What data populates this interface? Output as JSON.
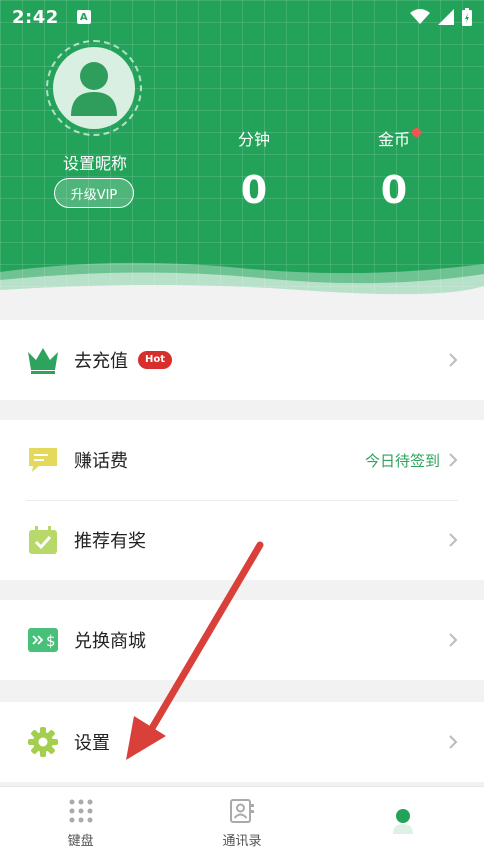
{
  "status_bar": {
    "time": "2:42",
    "app_icon_letter": "A"
  },
  "profile": {
    "nickname": "设置昵称",
    "vip_button": "升级VIP"
  },
  "stats": {
    "minutes_label": "分钟",
    "minutes_value": "0",
    "coins_label": "金币",
    "coins_value": "0"
  },
  "menu": {
    "recharge": {
      "label": "去充值",
      "badge": "Hot"
    },
    "earn": {
      "label": "赚话费",
      "status": "今日待签到"
    },
    "referral": {
      "label": "推荐有奖"
    },
    "mall": {
      "label": "兑换商城"
    },
    "settings": {
      "label": "设置"
    }
  },
  "bottom_nav": {
    "keypad": "键盘",
    "contacts": "通讯录",
    "me": ""
  },
  "colors": {
    "brand_green": "#23a35a",
    "hot_red": "#d72f2b",
    "annotation_arrow": "#d9403a"
  }
}
